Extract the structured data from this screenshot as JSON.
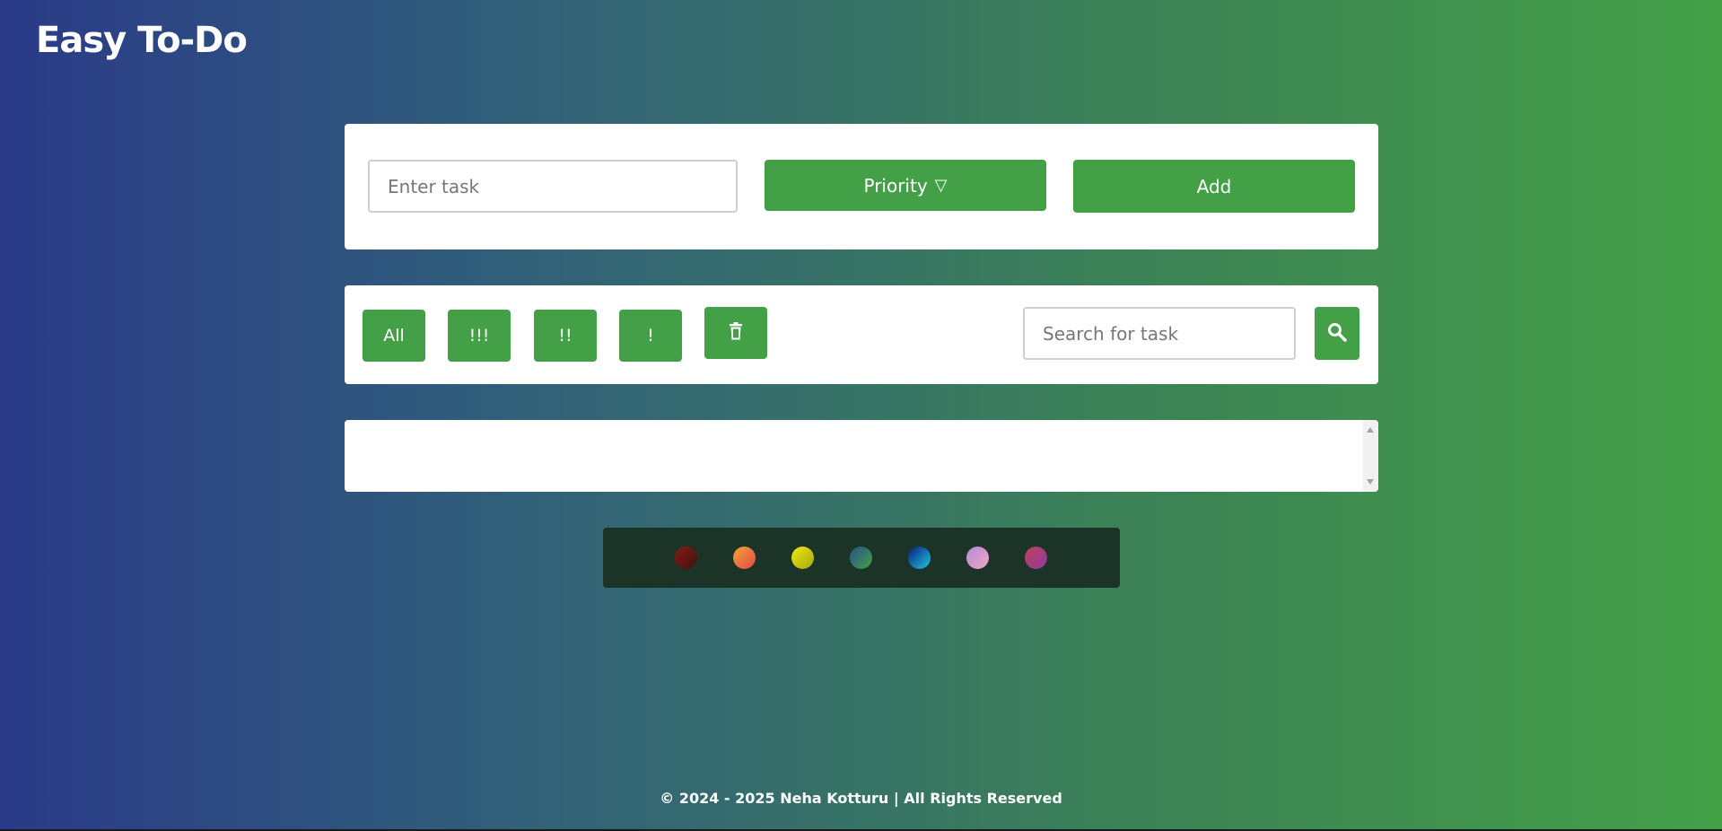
{
  "app": {
    "title": "Easy To-Do"
  },
  "add_task": {
    "input_placeholder": "Enter task",
    "priority_label": "Priority",
    "priority_icon": "triangle-down-icon",
    "add_label": "Add"
  },
  "filters": {
    "all_label": "All",
    "high_label": "!!!",
    "medium_label": "!!",
    "low_label": "!",
    "delete_icon": "trash-icon",
    "search_placeholder": "Search for task",
    "search_icon": "search-icon"
  },
  "task_list": {
    "items": []
  },
  "themes": {
    "swatches": [
      {
        "name": "dark-red",
        "from": "#8b1a14",
        "to": "#3d120f"
      },
      {
        "name": "orange",
        "from": "#f5a531",
        "to": "#e04848"
      },
      {
        "name": "yellow",
        "from": "#f2e80b",
        "to": "#a7a717"
      },
      {
        "name": "blue-green",
        "from": "#2a4f8a",
        "to": "#43a047"
      },
      {
        "name": "navy-cyan",
        "from": "#0a1a7a",
        "to": "#22c6e8"
      },
      {
        "name": "lavender-pink",
        "from": "#b489d9",
        "to": "#f0a7c4"
      },
      {
        "name": "crimson-purple",
        "from": "#c2415a",
        "to": "#8e3a9e"
      }
    ]
  },
  "colors": {
    "accent": "#43a047",
    "gradient_start": "#2a3a88",
    "gradient_end": "#43a047"
  },
  "footer": {
    "text": "© 2024 - 2025 Neha Kotturu | All Rights Reserved"
  }
}
